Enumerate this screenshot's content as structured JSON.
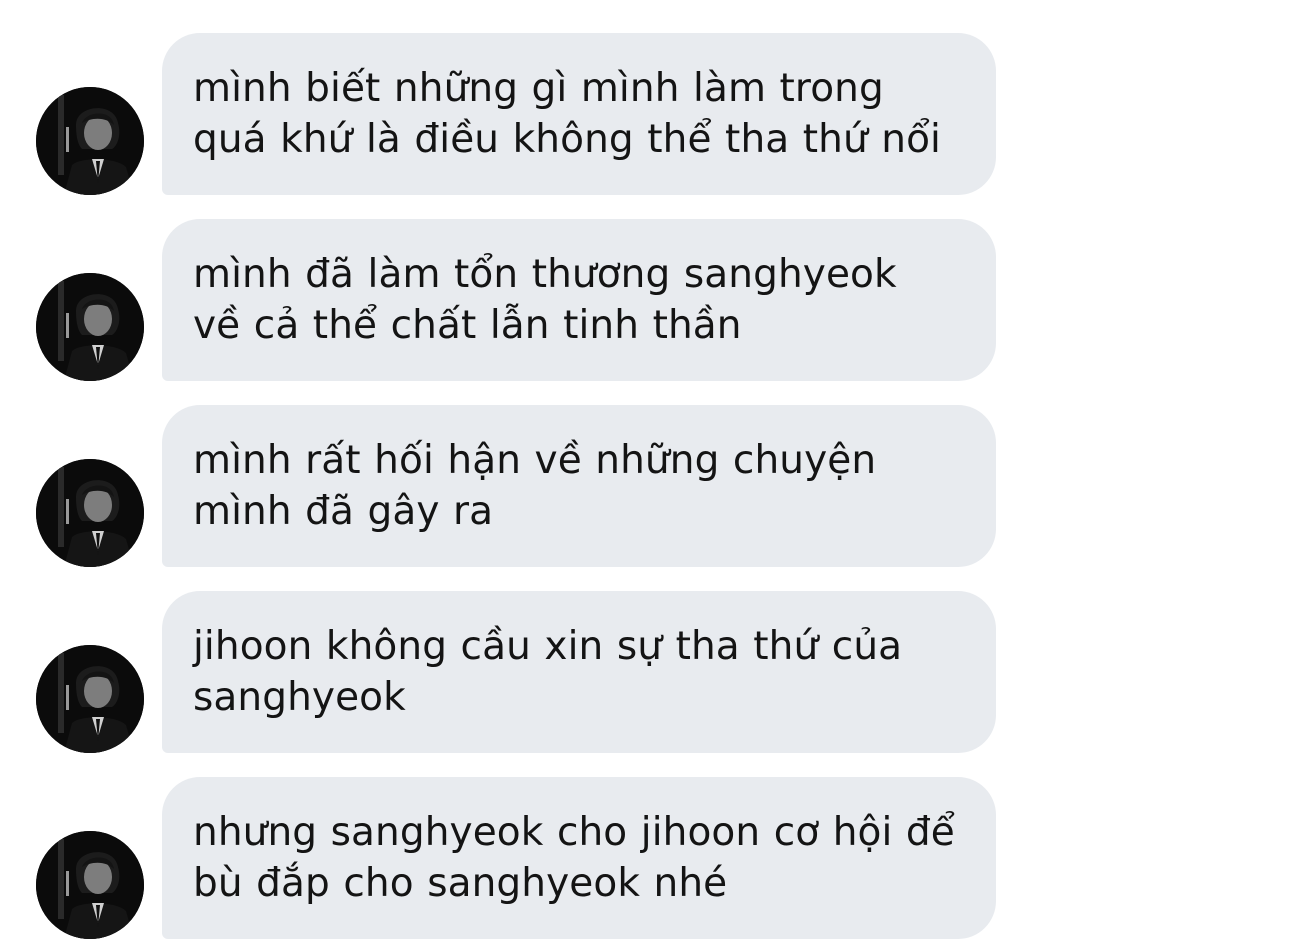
{
  "messages": [
    {
      "text": "mình biết những gì mình làm trong quá khứ là điều không thể tha thứ nổi",
      "avatar": "profile-photo-icon"
    },
    {
      "text": "mình đã làm tổn thương sanghyeok về cả thể chất lẫn tinh thần",
      "avatar": "profile-photo-icon"
    },
    {
      "text": "mình rất hối hận về những chuyện mình đã gây ra",
      "avatar": "profile-photo-icon"
    },
    {
      "text": "jihoon không cầu xin sự tha thứ của sanghyeok",
      "avatar": "profile-photo-icon"
    },
    {
      "text": "nhưng sanghyeok cho jihoon cơ hội để bù đắp cho sanghyeok nhé",
      "avatar": "profile-photo-icon"
    }
  ],
  "colors": {
    "bubble": "#e8ebef",
    "text": "#141414",
    "background": "#ffffff"
  }
}
